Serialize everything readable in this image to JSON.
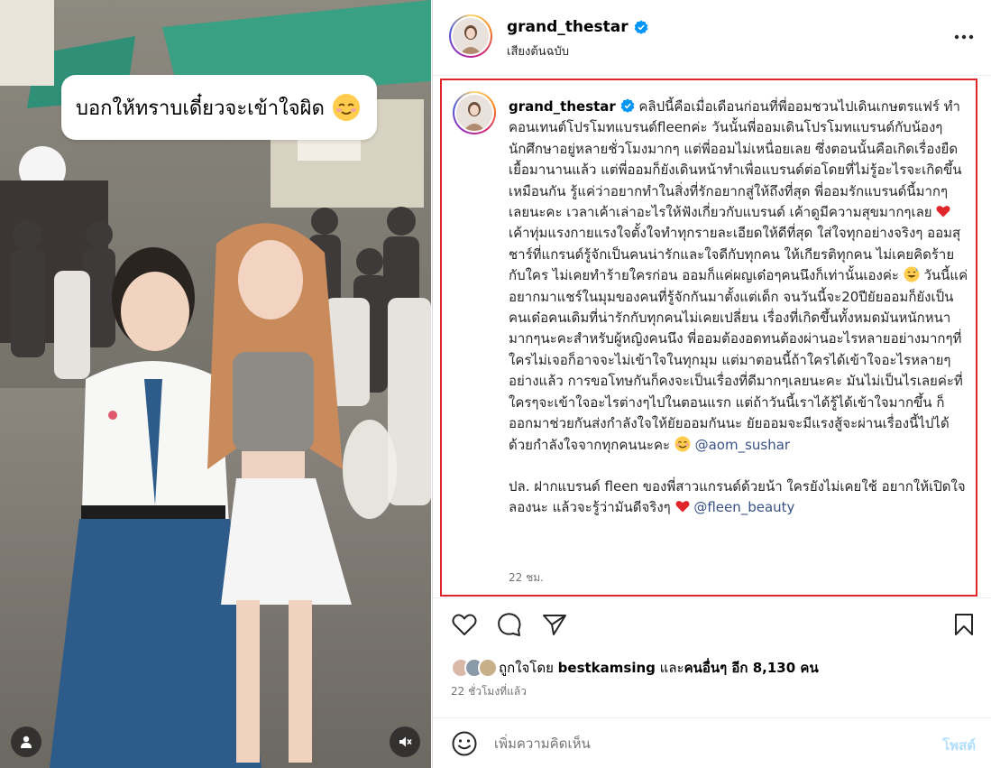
{
  "media": {
    "overlay_caption": "บอกให้ทราบเดี๋ยวจะเข้าใจผิด",
    "overlay_emoji": "relieved-face",
    "user_tag_icon": "person-icon",
    "mute_icon": "speaker-muted-icon"
  },
  "header": {
    "username": "grand_thestar",
    "verified": true,
    "audio_label": "เสียงต้นฉบับ",
    "more_icon": "more-horizontal-icon"
  },
  "caption": {
    "username": "grand_thestar",
    "body": "คลิปนี้คือเมื่อเดือนก่อนที่พี่ออมชวนไปเดินเกษตรแฟร์ ทำคอนเทนต์โปรโมทแบรนด์fleenค่ะ วันนั้นพี่ออมเดินโปรโมทแบรนด์กับน้องๆนักศึกษาอยู่หลายชั่วโมงมากๆ แต่พี่ออมไม่เหนื่อยเลย ซึ่งตอนนั้นคือเกิดเรื่องยืดเยื้อมานานแล้ว แต่พี่ออมก็ยังเดินหน้าทำเพื่อแบรนด์ต่อโดยที่ไม่รู้อะไรจะเกิดขึ้นเหมือนกัน รู้แค่ว่าอยากทำในสิ่งที่รักอยากสู่ให้ถึงที่สุด พี่ออมรักแบรนด์นี้มากๆเลยนะคะ เวลาเค้าเล่าอะไรให้ฟังเกี่ยวกับแบรนด์ เค้าดูมีความสุขมากๆเลย",
    "body_2": "เค้าทุ่มแรงกายแรงใจตั้งใจทำทุกรายละเอียดให้ดีที่สุด ใส่ใจทุกอย่างจริงๆ ออมสุชาร์ที่แกรนด์รู้จักเป็นคนน่ารักและใจดีกับทุกคน ให้เกียรติทุกคน ไม่เคยคิดร้ายกับใคร ไม่เคยทำร้ายใครก่อน ออมก็แค่ผญเด๋อๆคนนึงก็เท่านั้นเองค่ะ",
    "body_3": "วันนี้แค่อยากมาแชร์ในมุมของคนที่รู้จักกันมาตั้งแต่เด็ก จนวันนี้จะ20ปียัยออมก็ยังเป็นคนเด๋อคนเดิมที่น่ารักกับทุกคนไม่เคยเปลี่ยน เรื่องที่เกิดขึ้นทั้งหมดมันหนักหนามากๆนะคะสำหรับผู้หญิงคนนึง พี่ออมต้องอดทนต้องผ่านอะไรหลายอย่างมากๆที่ใครไม่เจอก็อาจจะไม่เข้าใจในทุกมุม แต่มาตอนนี้ถ้าใครได้เข้าใจอะไรหลายๆอย่างแล้ว การขอโทษกันก็คงจะเป็นเรื่องที่ดีมากๆเลยนะคะ มันไม่เป็นไรเลยค่ะที่ใครๆจะเข้าใจอะไรต่างๆไปในตอนแรก แต่ถ้าวันนี้เราได้รู้ได้เข้าใจมากขึ้น ก็ออกมาช่วยกันส่งกำลังใจให้ยัยออมกันนะ ยัยออมจะมีแรงสู้จะผ่านเรื่องนี้ไปได้ด้วยกำลังใจจากทุกคนนะคะ",
    "mention_1": "@aom_sushar",
    "ps": "ปล. ฝากแบรนด์ fleen ของพี่สาวแกรนด์ด้วยน้า ใครยังไม่เคยใช้ อยากให้เปิดใจลองนะ แล้วจะรู้ว่ามันดีจริงๆ",
    "mention_2": "@fleen_beauty",
    "timestamp": "22 ชม."
  },
  "actions": {
    "like_icon": "heart-icon",
    "comment_icon": "comment-icon",
    "share_icon": "send-icon",
    "save_icon": "bookmark-icon"
  },
  "likes": {
    "prefix": "ถูกใจโดย",
    "first_user": "bestkamsing",
    "and": "และ",
    "others": "คนอื่นๆ อีก 8,130 คน"
  },
  "post_age": "22 ชั่วโมงที่แล้ว",
  "comment": {
    "placeholder": "เพิ่มความคิดเห็น",
    "post_label": "โพสต์",
    "emoji_icon": "smiley-icon"
  },
  "colors": {
    "highlight_border": "#e0262b",
    "mention": "#385185",
    "verified": "#0095f6",
    "post_button_disabled": "#b2dffc"
  }
}
